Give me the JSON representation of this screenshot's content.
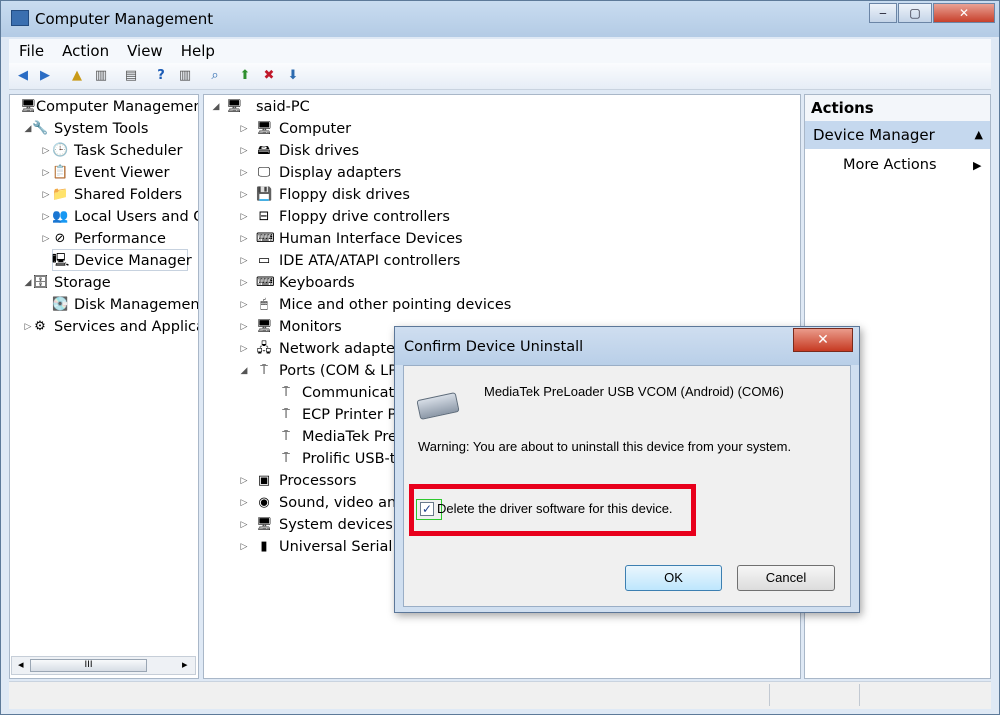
{
  "window": {
    "title": "Computer Management",
    "buttons": {
      "minimize": "‒",
      "maximize": "▢",
      "close": "✕"
    }
  },
  "menu": [
    "File",
    "Action",
    "View",
    "Help"
  ],
  "left_tree": [
    {
      "label": "Computer Management",
      "icon": "computer-management-icon",
      "glyph": "🖥",
      "level": 0,
      "toggle": ""
    },
    {
      "label": "System Tools",
      "icon": "tools-icon",
      "glyph": "🔧",
      "level": 1,
      "toggle": "◢"
    },
    {
      "label": "Task Scheduler",
      "icon": "clock-icon",
      "glyph": "🕒",
      "level": 2,
      "toggle": "▷"
    },
    {
      "label": "Event Viewer",
      "icon": "event-viewer-icon",
      "glyph": "📋",
      "level": 2,
      "toggle": "▷"
    },
    {
      "label": "Shared Folders",
      "icon": "shared-folder-icon",
      "glyph": "📁",
      "level": 2,
      "toggle": "▷"
    },
    {
      "label": "Local Users and Gr",
      "icon": "users-icon",
      "glyph": "👥",
      "level": 2,
      "toggle": "▷"
    },
    {
      "label": "Performance",
      "icon": "performance-icon",
      "glyph": "⊘",
      "level": 2,
      "toggle": "▷"
    },
    {
      "label": "Device Manager",
      "icon": "device-manager-icon",
      "glyph": "🖳",
      "level": 2,
      "toggle": ""
    },
    {
      "label": "Storage",
      "icon": "storage-icon",
      "glyph": "🗄",
      "level": 1,
      "toggle": "◢"
    },
    {
      "label": "Disk Management",
      "icon": "disk-management-icon",
      "glyph": "💽",
      "level": 2,
      "toggle": ""
    },
    {
      "label": "Services and Applicat",
      "icon": "services-icon",
      "glyph": "⚙",
      "level": 1,
      "toggle": "▷"
    }
  ],
  "device_tree": {
    "root": "said-PC",
    "items": [
      {
        "label": "Computer",
        "icon": "computer-icon",
        "glyph": "🖥",
        "toggle": "▷",
        "level": 1
      },
      {
        "label": "Disk drives",
        "icon": "disk-drive-icon",
        "glyph": "🖴",
        "toggle": "▷",
        "level": 1
      },
      {
        "label": "Display adapters",
        "icon": "display-adapter-icon",
        "glyph": "🖵",
        "toggle": "▷",
        "level": 1
      },
      {
        "label": "Floppy disk drives",
        "icon": "floppy-icon",
        "glyph": "💾",
        "toggle": "▷",
        "level": 1
      },
      {
        "label": "Floppy drive controllers",
        "icon": "controller-icon",
        "glyph": "⊟",
        "toggle": "▷",
        "level": 1
      },
      {
        "label": "Human Interface Devices",
        "icon": "hid-icon",
        "glyph": "⌨",
        "toggle": "▷",
        "level": 1
      },
      {
        "label": "IDE ATA/ATAPI controllers",
        "icon": "ide-icon",
        "glyph": "▭",
        "toggle": "▷",
        "level": 1
      },
      {
        "label": "Keyboards",
        "icon": "keyboard-icon",
        "glyph": "⌨",
        "toggle": "▷",
        "level": 1
      },
      {
        "label": "Mice and other pointing devices",
        "icon": "mouse-icon",
        "glyph": "🖱",
        "toggle": "▷",
        "level": 1
      },
      {
        "label": "Monitors",
        "icon": "monitor-icon",
        "glyph": "🖥",
        "toggle": "▷",
        "level": 1
      },
      {
        "label": "Network adapters",
        "icon": "network-icon",
        "glyph": "🖧",
        "toggle": "▷",
        "level": 1
      },
      {
        "label": "Ports (COM & LPT",
        "icon": "port-icon",
        "glyph": "⍑",
        "toggle": "◢",
        "level": 1
      },
      {
        "label": "Communicatio",
        "icon": "port-icon",
        "glyph": "⍑",
        "toggle": "",
        "level": 2
      },
      {
        "label": "ECP Printer Po",
        "icon": "port-icon",
        "glyph": "⍑",
        "toggle": "",
        "level": 2
      },
      {
        "label": "MediaTek Pre",
        "icon": "port-icon",
        "glyph": "⍑",
        "toggle": "",
        "level": 2
      },
      {
        "label": "Prolific USB-to",
        "icon": "port-icon",
        "glyph": "⍑",
        "toggle": "",
        "level": 2
      },
      {
        "label": "Processors",
        "icon": "processor-icon",
        "glyph": "▣",
        "toggle": "▷",
        "level": 1
      },
      {
        "label": "Sound, video and",
        "icon": "sound-icon",
        "glyph": "◉",
        "toggle": "▷",
        "level": 1
      },
      {
        "label": "System devices",
        "icon": "system-device-icon",
        "glyph": "🖥",
        "toggle": "▷",
        "level": 1
      },
      {
        "label": "Universal Serial Bu",
        "icon": "usb-icon",
        "glyph": "▮",
        "toggle": "▷",
        "level": 1
      }
    ]
  },
  "actions": {
    "header": "Actions",
    "section": "Device Manager",
    "more": "More Actions"
  },
  "scrollbar": {
    "grip": "III",
    "left": "◂",
    "right": "▸"
  },
  "dialog": {
    "title": "Confirm Device Uninstall",
    "close": "✕",
    "device_name": "MediaTek PreLoader USB VCOM (Android) (COM6)",
    "warning": "Warning: You are about to uninstall this device from your system.",
    "checkbox_label": "Delete the driver software for this device.",
    "checkbox_checked": true,
    "ok": "OK",
    "cancel": "Cancel"
  },
  "colors": {
    "highlight": "#e8001c",
    "selection": "#c5d8ee"
  }
}
